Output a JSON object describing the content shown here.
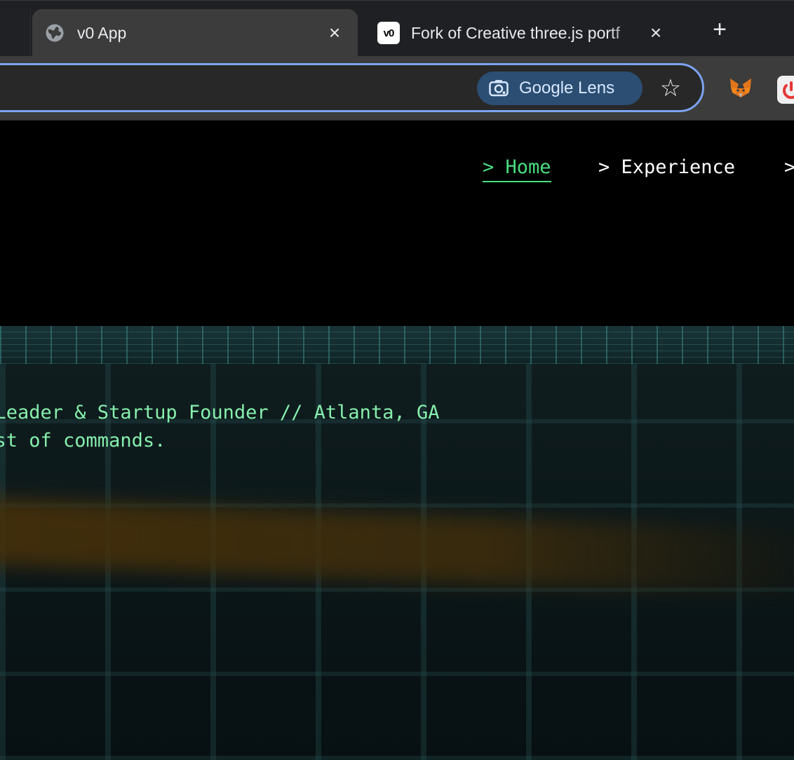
{
  "browser": {
    "tabs": [
      {
        "title": "v0 App",
        "icon": "globe-icon",
        "active": true
      },
      {
        "title": "Fork of Creative three.js portf",
        "icon": "v0-logo-icon",
        "favicon_text": "v0",
        "active": false
      }
    ],
    "new_tab_label": "+",
    "close_glyph": "×",
    "lens_label": "Google Lens",
    "accent_color": "#7ca3f1"
  },
  "nav": {
    "items": [
      {
        "label": "> Home",
        "active": true
      },
      {
        "label": "> Experience",
        "active": false
      },
      {
        "label": ">",
        "active": false
      }
    ],
    "active_color": "#4ade80"
  },
  "hero": {
    "line1": "g Leader & Startup Founder // Atlanta, GA",
    "line2": "list of commands."
  }
}
